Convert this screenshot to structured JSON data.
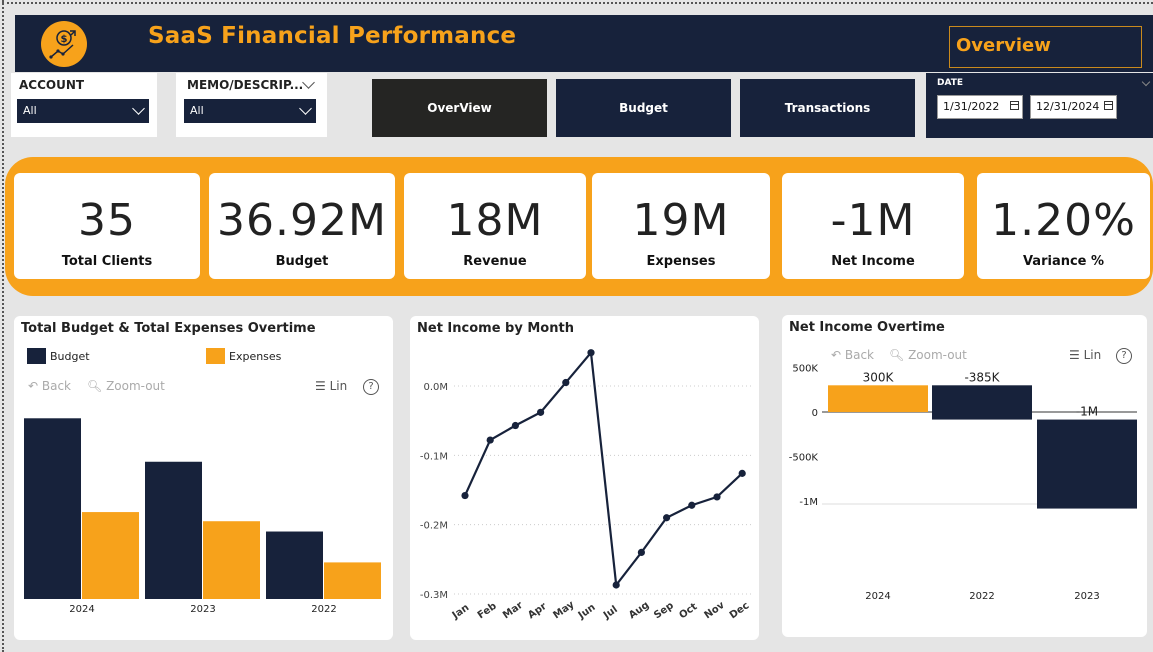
{
  "header": {
    "title": "SaaS Financial Performance",
    "page_tag": "Overview",
    "accent": "#f7a21b",
    "navy": "#17223b",
    "logo_icon": "dollar-growth-icon"
  },
  "filters": {
    "account": {
      "label": "ACCOUNT",
      "value": "All"
    },
    "memo": {
      "label": "MEMO/DESCRIP...",
      "value": "All"
    }
  },
  "nav": {
    "overview": "OverView",
    "budget": "Budget",
    "transactions": "Transactions"
  },
  "date": {
    "label": "DATE",
    "start": "1/31/2022",
    "end": "12/31/2024"
  },
  "kpis": [
    {
      "value": "35",
      "label": "Total Clients"
    },
    {
      "value": "36.92M",
      "label": "Budget"
    },
    {
      "value": "18M",
      "label": "Revenue"
    },
    {
      "value": "19M",
      "label": "Expenses"
    },
    {
      "value": "-1M",
      "label": "Net Income"
    },
    {
      "value": "1.20%",
      "label": "Variance %"
    }
  ],
  "toolbar": {
    "back": "Back",
    "zoom_out": "Zoom-out",
    "lin": "Lin",
    "help": "?"
  },
  "chart_data": [
    {
      "type": "bar",
      "title": "Total Budget & Total Expenses Overtime",
      "categories": [
        "2024",
        "2023",
        "2022"
      ],
      "series": [
        {
          "name": "Budget",
          "color": "#17223b",
          "values": [
            15.8,
            12.0,
            5.9
          ]
        },
        {
          "name": "Expenses",
          "color": "#f7a21b",
          "values": [
            7.6,
            6.8,
            3.2
          ]
        }
      ],
      "ylim": [
        0,
        16
      ]
    },
    {
      "type": "line",
      "title": "Net Income by Month",
      "x": [
        "Jan",
        "Feb",
        "Mar",
        "Apr",
        "May",
        "Jun",
        "Jul",
        "Aug",
        "Sep",
        "Oct",
        "Nov",
        "Dec"
      ],
      "y_ticks": [
        "0.0M",
        "-0.1M",
        "-0.2M",
        "-0.3M"
      ],
      "ylim": [
        -0.3,
        0.05
      ],
      "values": [
        -0.158,
        -0.078,
        -0.057,
        -0.038,
        0.005,
        0.048,
        -0.287,
        -0.24,
        -0.19,
        -0.172,
        -0.16,
        -0.126
      ],
      "color": "#17223b"
    },
    {
      "type": "bar",
      "title": "Net Income Overtime",
      "categories": [
        "2024",
        "2022",
        "2023"
      ],
      "values": [
        300,
        -385,
        -1000
      ],
      "data_labels": [
        "300K",
        "-385K",
        "-1M"
      ],
      "colors": [
        "#f7a21b",
        "#17223b",
        "#17223b"
      ],
      "y_ticks": [
        "500K",
        "0",
        "-500K",
        "-1M"
      ],
      "ylim": [
        -1200,
        500
      ],
      "chart_form": "waterfall"
    }
  ]
}
